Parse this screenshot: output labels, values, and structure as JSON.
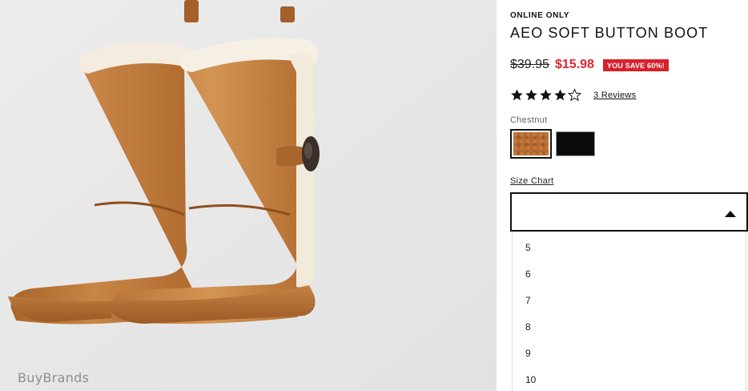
{
  "image": {
    "alt_icon": "boots-illustration",
    "watermark": "BuyBrands"
  },
  "product": {
    "badge": "ONLINE ONLY",
    "title": "AEO SOFT BUTTON BOOT",
    "price_original": "$39.95",
    "price_sale": "$15.98",
    "save_badge": "YOU SAVE 60%!",
    "rating": 4,
    "rating_max": 5,
    "reviews_link": "3 Reviews",
    "color_label": "Chestnut",
    "colors": [
      {
        "name": "chestnut",
        "hex": "#b56b32",
        "selected": true
      },
      {
        "name": "black",
        "hex": "#0c0c0c",
        "selected": false
      }
    ],
    "size_chart_link": "Size Chart"
  },
  "size_dropdown": {
    "selected": "",
    "options": [
      "5",
      "6",
      "7",
      "8",
      "9",
      "10"
    ]
  },
  "colors": {
    "sale": "#e1262e",
    "badge_bg": "#d8202a"
  }
}
